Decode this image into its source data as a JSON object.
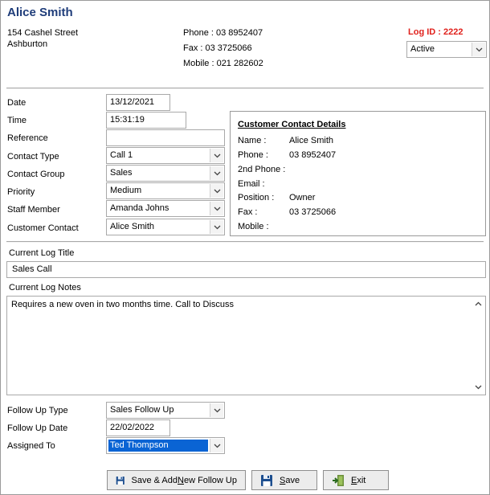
{
  "header": {
    "customer_name": "Alice Smith",
    "address_line1": "154 Cashel Street",
    "address_line2": "Ashburton",
    "phone": "Phone : 03 8952407",
    "fax": "Fax : 03 3725066",
    "mobile": "Mobile : 021 282602",
    "log_id": "Log ID : 2222",
    "status": "Active"
  },
  "form": {
    "date_label": "Date",
    "date_value": "13/12/2021",
    "time_label": "Time",
    "time_value": "15:31:19",
    "reference_label": "Reference",
    "reference_value": "",
    "contact_type_label": "Contact Type",
    "contact_type_value": "Call 1",
    "contact_group_label": "Contact Group",
    "contact_group_value": "Sales",
    "priority_label": "Priority",
    "priority_value": "Medium",
    "staff_member_label": "Staff Member",
    "staff_member_value": "Amanda Johns",
    "customer_contact_label": "Customer Contact",
    "customer_contact_value": "Alice Smith"
  },
  "contact_details": {
    "title": "Customer Contact Details",
    "rows": [
      {
        "label": "Name :",
        "value": "Alice Smith"
      },
      {
        "label": "Phone :",
        "value": "03 8952407"
      },
      {
        "label": "2nd Phone :",
        "value": ""
      },
      {
        "label": "Email :",
        "value": ""
      },
      {
        "label": "Position :",
        "value": "Owner"
      },
      {
        "label": "Fax :",
        "value": "03 3725066"
      },
      {
        "label": "Mobile :",
        "value": ""
      }
    ]
  },
  "log": {
    "title_label": "Current Log Title",
    "title_value": "Sales Call",
    "notes_label": "Current Log Notes",
    "notes_value": "Requires a new oven in two months time.  Call to Discuss"
  },
  "follow_up": {
    "type_label": "Follow Up Type",
    "type_value": "Sales Follow Up",
    "date_label": "Follow Up Date",
    "date_value": "22/02/2022",
    "assigned_label": "Assigned To",
    "assigned_value": "Ted Thompson"
  },
  "buttons": {
    "save_add": {
      "pre": "Save & Add ",
      "underline": "N",
      "post": "ew Follow Up"
    },
    "save": {
      "pre": "",
      "underline": "S",
      "post": "ave"
    },
    "exit": {
      "pre": "",
      "underline": "E",
      "post": "xit"
    }
  },
  "icons": {
    "save": "floppy-disk-icon",
    "exit": "exit-door-icon",
    "dropdown": "chevron-down-icon"
  },
  "colors": {
    "title": "#1f3d7a",
    "log_id": "#e0201b",
    "selection": "#0a64d4"
  }
}
